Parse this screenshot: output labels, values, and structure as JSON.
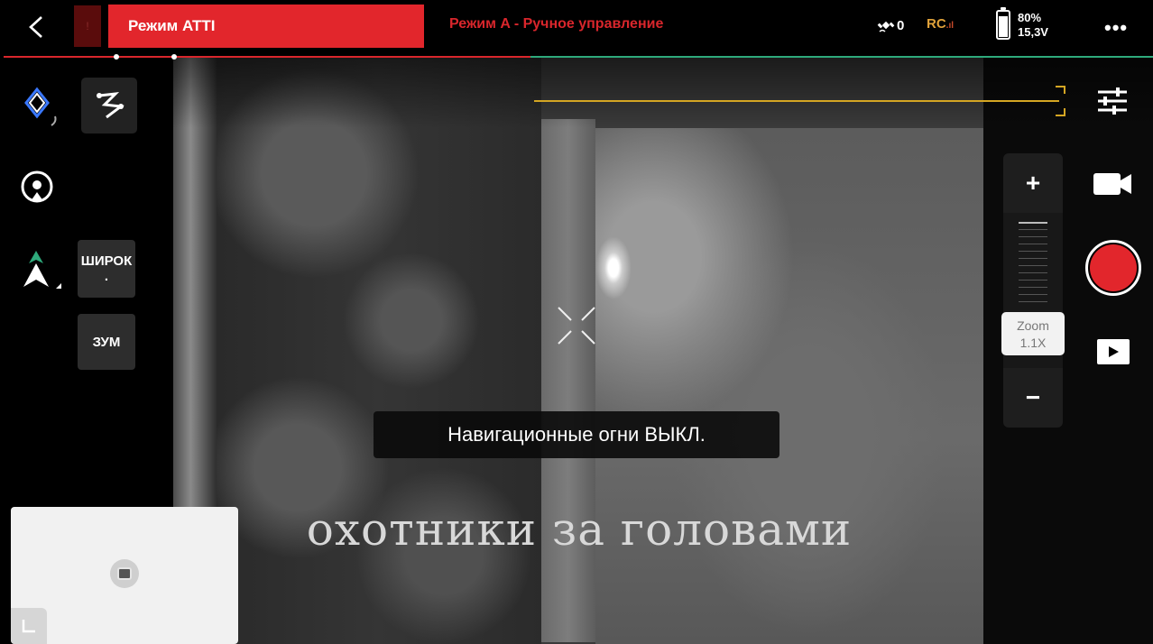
{
  "topbar": {
    "mode_marker": "!",
    "mode_banner": "Режим ATTI",
    "mode_subtitle": "Режим A - Ручное управление",
    "gps_count": "0",
    "rc_label": "RC",
    "rc_signal": ".ıl",
    "battery_percent": "80%",
    "battery_level": 0.8,
    "battery_voltage": "15,3V",
    "more_label": "•••"
  },
  "left_panel": {
    "lens_wide_label": "ШИРОК",
    "lens_wide_dot": ".",
    "lens_zoom_label": "ЗУМ",
    "icons": [
      "waypoint-icon",
      "flight-path-icon",
      "return-home-icon",
      "compass-icon"
    ]
  },
  "zoom": {
    "plus": "+",
    "minus": "−",
    "label": "Zoom",
    "value": "1.1X"
  },
  "toast": {
    "text": "Навигационные огни ВЫКЛ."
  },
  "overlay": {
    "subtitle": "охотники за головами"
  },
  "colors": {
    "accent_red": "#e2262c",
    "timeline_green": "#2ea97b",
    "rc_orange": "#e0a23a"
  }
}
